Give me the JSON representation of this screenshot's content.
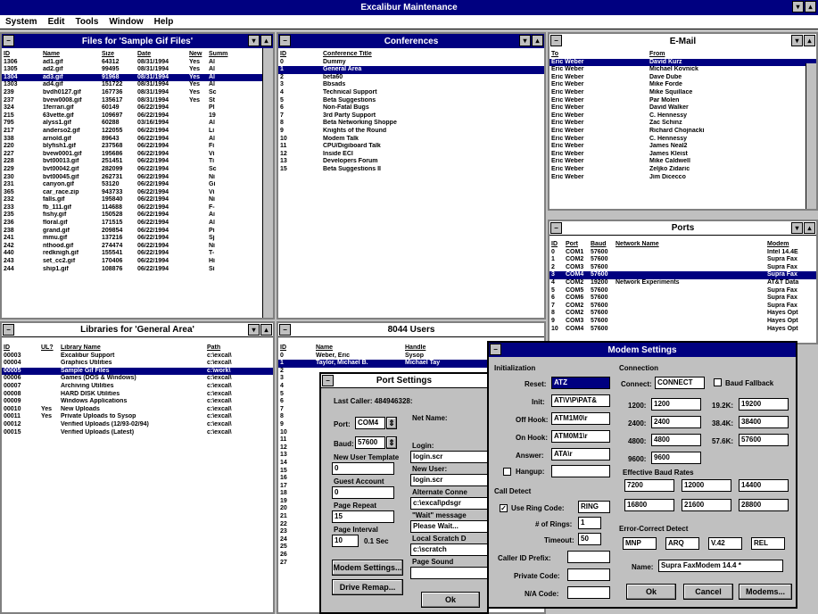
{
  "app": {
    "title": "Excalibur Maintenance",
    "menu": [
      "System",
      "Edit",
      "Tools",
      "Window",
      "Help"
    ]
  },
  "files": {
    "title": "Files for 'Sample Gif Files'",
    "cols": [
      "ID",
      "Name",
      "Size",
      "Date",
      "New",
      "Summ"
    ],
    "rows": [
      [
        "1306",
        "ad1.gif",
        "64312",
        "08/31/1994",
        "Yes",
        "Al"
      ],
      [
        "1305",
        "ad2.gif",
        "99495",
        "08/31/1994",
        "Yes",
        "Al"
      ],
      [
        "1304",
        "ad3.gif",
        "91968",
        "08/31/1994",
        "Yes",
        "Al"
      ],
      [
        "1303",
        "ad4.gif",
        "151722",
        "08/31/1994",
        "Yes",
        "Al"
      ],
      [
        "239",
        "bvdh0127.gif",
        "167736",
        "08/31/1994",
        "Yes",
        "Sc"
      ],
      [
        "237",
        "bvew0008.gif",
        "135617",
        "08/31/1994",
        "Yes",
        "St"
      ],
      [
        "324",
        "1ferrari.gif",
        "60149",
        "06/22/1994",
        "",
        "Pl"
      ],
      [
        "215",
        "63vette.gif",
        "109697",
        "06/22/1994",
        "",
        "19"
      ],
      [
        "795",
        "alyss1.gif",
        "60288",
        "03/16/1994",
        "",
        "Al"
      ],
      [
        "217",
        "anderso2.gif",
        "122055",
        "06/22/1994",
        "",
        "Li"
      ],
      [
        "338",
        "arnold.gif",
        "89643",
        "06/22/1994",
        "",
        "Al"
      ],
      [
        "220",
        "blyfish1.gif",
        "237568",
        "06/22/1994",
        "",
        "Fi"
      ],
      [
        "227",
        "bvew0001.gif",
        "195686",
        "06/22/1994",
        "",
        "Vi"
      ],
      [
        "228",
        "bvt00013.gif",
        "251451",
        "06/22/1994",
        "",
        "Ti"
      ],
      [
        "229",
        "bvt00042.gif",
        "282099",
        "06/22/1994",
        "",
        "Sc"
      ],
      [
        "230",
        "bvt00045.gif",
        "262731",
        "06/22/1994",
        "",
        "Ni"
      ],
      [
        "231",
        "canyon.gif",
        "53120",
        "06/22/1994",
        "",
        "Gi"
      ],
      [
        "365",
        "car_race.zip",
        "943733",
        "06/22/1994",
        "",
        "Vi"
      ],
      [
        "232",
        "falls.gif",
        "195840",
        "06/22/1994",
        "",
        "Ni"
      ],
      [
        "233",
        "fb_111.gif",
        "114688",
        "06/22/1994",
        "",
        "F-"
      ],
      [
        "235",
        "fishy.gif",
        "150528",
        "06/22/1994",
        "",
        "Ai"
      ],
      [
        "236",
        "floral.gif",
        "171515",
        "06/22/1994",
        "",
        "Al"
      ],
      [
        "238",
        "grand.gif",
        "209854",
        "06/22/1994",
        "",
        "Pi"
      ],
      [
        "241",
        "mmu.gif",
        "137216",
        "06/22/1994",
        "",
        "Sj"
      ],
      [
        "242",
        "nthood.gif",
        "274474",
        "06/22/1994",
        "",
        "Ni"
      ],
      [
        "440",
        "redknigh.gif",
        "155541",
        "06/22/1994",
        "",
        "T-"
      ],
      [
        "243",
        "set_cc2.gif",
        "170406",
        "06/22/1994",
        "",
        "Hi"
      ],
      [
        "244",
        "ship1.gif",
        "108876",
        "06/22/1994",
        "",
        "Si"
      ]
    ]
  },
  "conferences": {
    "title": "Conferences",
    "cols": [
      "ID",
      "Conference Title"
    ],
    "rows": [
      [
        "0",
        "Dummy"
      ],
      [
        "1",
        "General Area"
      ],
      [
        "2",
        "beta60"
      ],
      [
        "3",
        "Bbsads"
      ],
      [
        "4",
        "Technical Support"
      ],
      [
        "5",
        "Beta Suggestions"
      ],
      [
        "6",
        "Non-Fatal Bugs"
      ],
      [
        "7",
        "3rd Party Support"
      ],
      [
        "8",
        "Beta Networking Shoppe"
      ],
      [
        "9",
        "Knights of the Round"
      ],
      [
        "10",
        "Modem Talk"
      ],
      [
        "11",
        "CPU/Digiboard Talk"
      ],
      [
        "12",
        "Inside ECI"
      ],
      [
        "13",
        "Developers Forum"
      ],
      [
        "15",
        "Beta Suggestions II"
      ]
    ]
  },
  "email": {
    "title": "E-Mail",
    "cols": [
      "To",
      "From"
    ],
    "rows": [
      [
        "Eric Weber",
        "David Kurz"
      ],
      [
        "Eric Weber",
        "Michael Kovnick"
      ],
      [
        "Eric Weber",
        "Dave Dube"
      ],
      [
        "Eric Weber",
        "Mike Forde"
      ],
      [
        "Eric Weber",
        "Mike Squillace"
      ],
      [
        "Eric Weber",
        "Par Molen"
      ],
      [
        "Eric Weber",
        "David Walker"
      ],
      [
        "Eric Weber",
        "C. Hennessy"
      ],
      [
        "Eric Weber",
        "Zac Schinz"
      ],
      [
        "Eric Weber",
        "Richard Chojnacki"
      ],
      [
        "Eric Weber",
        "C. Hennessy"
      ],
      [
        "Eric Weber",
        "James Neal2"
      ],
      [
        "Eric Weber",
        "James Kleist"
      ],
      [
        "Eric Weber",
        "Mike Caldwell"
      ],
      [
        "Eric Weber",
        "Zeljko Zidaric"
      ],
      [
        "Eric Weber",
        "Jim Dicecco"
      ]
    ]
  },
  "ports": {
    "title": "Ports",
    "cols": [
      "ID",
      "Port",
      "Baud",
      "Network Name",
      "Modem"
    ],
    "rows": [
      [
        "0",
        "COM1",
        "57600",
        "",
        "Intel 14.4E"
      ],
      [
        "1",
        "COM2",
        "57600",
        "",
        "Supra Fax"
      ],
      [
        "2",
        "COM3",
        "57600",
        "",
        "Supra Fax"
      ],
      [
        "3",
        "COM4",
        "57600",
        "",
        "Supra Fax"
      ],
      [
        "4",
        "COM2",
        "19200",
        "Network Experiments",
        "AT&T Data"
      ],
      [
        "5",
        "COM5",
        "57600",
        "",
        "Supra Fax"
      ],
      [
        "6",
        "COM6",
        "57600",
        "",
        "Supra Fax"
      ],
      [
        "7",
        "COM2",
        "57600",
        "",
        "Supra Fax"
      ],
      [
        "8",
        "COM2",
        "57600",
        "",
        "Hayes Opt"
      ],
      [
        "9",
        "COM3",
        "57600",
        "",
        "Hayes Opt"
      ],
      [
        "10",
        "COM4",
        "57600",
        "",
        "Hayes Opt"
      ]
    ]
  },
  "libraries": {
    "title": "Libraries for 'General Area'",
    "cols": [
      "ID",
      "UL?",
      "Library Name",
      "Path"
    ],
    "rows": [
      [
        "00003",
        "",
        "Excalibur Support",
        "c:\\excal\\"
      ],
      [
        "00004",
        "",
        "Graphics Utilities",
        "c:\\excal\\"
      ],
      [
        "00005",
        "",
        "Sample Gif Files",
        "c:\\work\\"
      ],
      [
        "00006",
        "",
        "Games (DOS & Windows)",
        "c:\\excal\\"
      ],
      [
        "00007",
        "",
        "Archiving Utilities",
        "c:\\excal\\"
      ],
      [
        "00008",
        "",
        "HARD DISK Utilities",
        "c:\\excal\\"
      ],
      [
        "00009",
        "",
        "Windows Applications",
        "c:\\excal\\"
      ],
      [
        "00010",
        "Yes",
        "New Uploads",
        "c:\\excal\\"
      ],
      [
        "00011",
        "Yes",
        "Private Uploads to Sysop",
        "c:\\excal\\"
      ],
      [
        "00012",
        "",
        "Verified Uploads (12/93-02/94)",
        "c:\\excal\\"
      ],
      [
        "00015",
        "",
        "Verified Uploads (Latest)",
        "c:\\excal\\"
      ]
    ]
  },
  "users": {
    "title": "8044 Users",
    "cols": [
      "ID",
      "Name",
      "Handle"
    ],
    "rows": [
      [
        "0",
        "Weber, Eric",
        "Sysop"
      ],
      [
        "1",
        "Taylor, Michael B.",
        "Michael Tay"
      ]
    ],
    "ids": [
      "2",
      "3",
      "4",
      "5",
      "6",
      "7",
      "8",
      "9",
      "10",
      "11",
      "12",
      "13",
      "14",
      "15",
      "16",
      "17",
      "18",
      "19",
      "20",
      "21",
      "22",
      "23",
      "24",
      "25",
      "26",
      "27"
    ]
  },
  "port_settings": {
    "title": "Port Settings",
    "last_caller": "Last Caller: 484946328:",
    "port_label": "Port:",
    "port": "COM4",
    "baud_label": "Baud:",
    "baud": "57600",
    "new_user_template_label": "New User Template",
    "new_user_template": "0",
    "guest_account_label": "Guest Account",
    "guest_account": "0",
    "page_repeat_label": "Page Repeat",
    "page_repeat": "15",
    "page_interval_label": "Page Interval",
    "page_interval": "10",
    "page_interval_unit": "0.1 Sec",
    "net_name_label": "Net Name:",
    "login_label": "Login:",
    "login": "login.scr",
    "new_user_label": "New User:",
    "new_user": "login.scr",
    "alt_conn_label": "Alternate Conne",
    "alt_conn": "c:\\excal\\pdsgr",
    "wait_label": "\"Wait\" message",
    "wait": "Please Wait...",
    "scratch_label": "Local Scratch D",
    "scratch": "c:\\scratch",
    "page_sound_label": "Page Sound",
    "modem_settings_btn": "Modem Settings...",
    "drive_remap_btn": "Drive Remap...",
    "ok_btn": "Ok"
  },
  "modem": {
    "title": "Modem Settings",
    "init_group": "Initialization",
    "reset_label": "Reset:",
    "reset": "ATZ",
    "init_label": "Init:",
    "init": "AT\\V\\P\\PAT&",
    "offhook_label": "Off Hook:",
    "offhook": "ATM1M0\\r",
    "onhook_label": "On Hook:",
    "onhook": "ATM0M1\\r",
    "answer_label": "Answer:",
    "answer": "ATA\\r",
    "hangup_label": "Hangup:",
    "conn_group": "Connection",
    "connect_label": "Connect:",
    "connect": "CONNECT",
    "baud_fallback": "Baud Fallback",
    "c1200_label": "1200:",
    "c1200": "1200",
    "c19200_label": "19.2K:",
    "c19200": "19200",
    "c2400_label": "2400:",
    "c2400": "2400",
    "c38400_label": "38.4K:",
    "c38400": "38400",
    "c4800_label": "4800:",
    "c4800": "4800",
    "c57600_label": "57.6K:",
    "c57600": "57600",
    "c9600_label": "9600:",
    "c9600": "9600",
    "eff_group": "Effective Baud Rates",
    "eff": [
      "7200",
      "12000",
      "14400",
      "16800",
      "21600",
      "28800"
    ],
    "call_group": "Call Detect",
    "use_ring_label": "Use Ring Code:",
    "ring_code": "RING",
    "num_rings_label": "# of Rings:",
    "num_rings": "1",
    "timeout_label": "Timeout:",
    "timeout": "50",
    "callerid_label": "Caller ID Prefix:",
    "private_label": "Private Code:",
    "na_label": "N/A Code:",
    "err_group": "Error-Correct Detect",
    "err": [
      "MNP",
      "ARQ",
      "V.42",
      "REL"
    ],
    "name_label": "Name:",
    "name": "Supra FaxModem 14.4 *",
    "ok_btn": "Ok",
    "cancel_btn": "Cancel",
    "modems_btn": "Modems..."
  },
  "colors": {
    "title_active": "#000080",
    "highlight": "#000080",
    "background": "#c0c0c0"
  }
}
